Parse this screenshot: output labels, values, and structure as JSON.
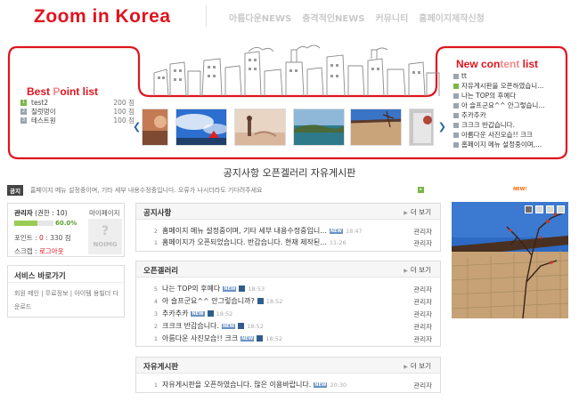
{
  "header": {
    "logo": "Zoom in Korea",
    "nav": [
      "아름다운NEWS",
      "충격적인NEWS",
      "커뮤니티",
      "홈페이지제작신청"
    ]
  },
  "best_point": {
    "title_a": "Best ",
    "title_b": "P",
    "title_c": "oint list",
    "rows": [
      {
        "rank": "1",
        "name": "test2",
        "points": "200 점"
      },
      {
        "rank": "2",
        "name": "질럿멍이",
        "points": "100 점"
      },
      {
        "rank": "3",
        "name": "테스트원",
        "points": "100 점"
      }
    ]
  },
  "new_content": {
    "title_a": "New con",
    "title_b": "tent",
    "title_c": " list",
    "rows": [
      "tt",
      "자유게시판을 오픈하였습니...",
      "나는 TOP의 후예다",
      "아 슬프군요^^ 안그렇습니...",
      "추카추카",
      "크크크 반갑습니다.",
      "아름다운 사진모습!! 크크",
      "홈페이지 메뉴 설정중이며,..."
    ]
  },
  "menu_line": "공지사항 오픈겔러리 자유게시판",
  "notice_strip": {
    "tag": "공지",
    "text": "홈페이지 메뉴 설정중이며, 기타 세부 내용수정중입니다. 오류가 나시더라도 기다려주세요",
    "new_badge": "NEW!"
  },
  "member": {
    "name_bold": "관리자",
    "name_rest": " (권한 : 10)",
    "mypage": "마이페이지",
    "progress": 0.6,
    "progress_label": "60.0%",
    "point_label": "포인트 : ",
    "point_value": "0",
    "point_sep": " : ",
    "point_total": "330 점",
    "scrap_label": "스크랩 : ",
    "logout": "로그아웃",
    "photo_q": "?",
    "photo_text": "NOIMG"
  },
  "service": {
    "title": "서비스 바로가기",
    "links": "회원 메인 | 무료정보 | 아이템 용빌더 다운로드"
  },
  "boards": {
    "notice": {
      "title": "공지사항",
      "more": "더 보기",
      "rows": [
        {
          "num": "2",
          "subject": "홈페이지 메뉴 설정중이며, 기타 세부 내용수정중입니...",
          "new": "NEW",
          "time": "18:47",
          "author": "관리자",
          "disk": false
        },
        {
          "num": "1",
          "subject": "홈페이지가 오픈되었습니다. 반갑습니다. 현재 제작된...",
          "new": "",
          "time": "11-26",
          "author": "관리자",
          "disk": false
        }
      ]
    },
    "gallery": {
      "title": "오픈겔러리",
      "more": "더 보기",
      "rows": [
        {
          "num": "5",
          "subject": "나는 TOP의 후예다",
          "new": "NEW",
          "time": "18:53",
          "author": "관리자",
          "disk": true
        },
        {
          "num": "4",
          "subject": "아 슬프군요^^ 안그렇습니까?",
          "new": "NEW",
          "time": "18:52",
          "author": "관리자",
          "disk": true
        },
        {
          "num": "3",
          "subject": "추카추카",
          "new": "NEW",
          "time": "18:52",
          "author": "관리자",
          "disk": true
        },
        {
          "num": "2",
          "subject": "크크크 반갑습니다.",
          "new": "NEW",
          "time": "18:52",
          "author": "관리자",
          "disk": true
        },
        {
          "num": "1",
          "subject": "아름다운 사진모습!! 크크",
          "new": "NEW",
          "time": "18:52",
          "author": "관리자",
          "disk": true
        }
      ]
    },
    "free": {
      "title": "자유게시판",
      "more": "더 보기",
      "rows": [
        {
          "num": "1",
          "subject": "자유게시판을 오픈하였습니다. 많은 이용바랍니다.",
          "new": "NEW",
          "time": "20:30",
          "author": "관리자",
          "disk": false
        }
      ]
    }
  },
  "icons": {
    "rank_badge": "rank-badge-icon",
    "more_arrow": "caret-right-icon",
    "disk": "floppy-disk-icon"
  },
  "colors": {
    "brand_red": "#e0141e",
    "green": "#7ab648",
    "blue_arrow": "#2b6aa6"
  }
}
